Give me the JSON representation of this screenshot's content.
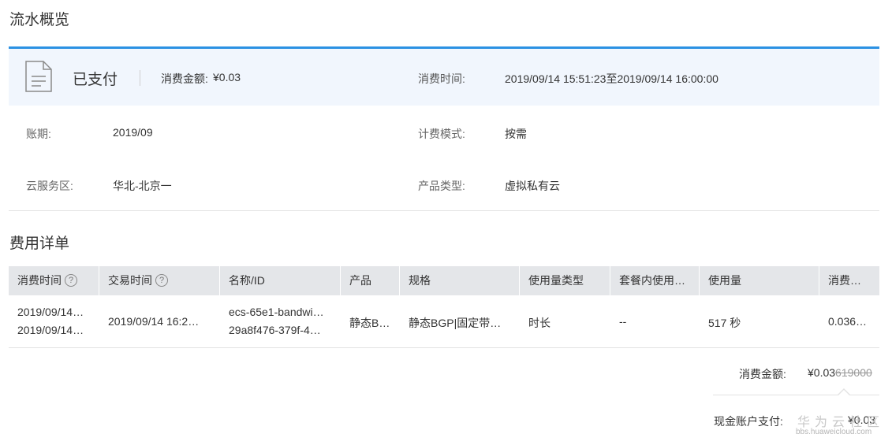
{
  "page_title": "流水概览",
  "summary": {
    "status": "已支付",
    "amount_label": "消费金额:",
    "amount_value": "¥0.03",
    "time_label": "消费时间:",
    "time_value": "2019/09/14 15:51:23至2019/09/14 16:00:00",
    "info": [
      {
        "label": "账期:",
        "value": "2019/09"
      },
      {
        "label": "计费模式:",
        "value": "按需"
      },
      {
        "label": "云服务区:",
        "value": "华北-北京一"
      },
      {
        "label": "产品类型:",
        "value": "虚拟私有云"
      }
    ]
  },
  "detail": {
    "title": "费用详单",
    "columns": [
      "消费时间",
      "交易时间",
      "名称/ID",
      "产品",
      "规格",
      "使用量类型",
      "套餐内使用…",
      "使用量",
      "消费…"
    ],
    "help_icon": "question-circle-icon",
    "row": {
      "consume_time": [
        "2019/09/14…",
        "2019/09/14…"
      ],
      "trade_time": "2019/09/14 16:2…",
      "name_id": [
        "ecs-65e1-bandwi…",
        "29a8f476-379f-4…"
      ],
      "product": "静态B…",
      "spec": "静态BGP|固定带…",
      "usage_type": "时长",
      "package_usage": "--",
      "usage": "517 秒",
      "amount": "0.036…"
    }
  },
  "totals": {
    "amount_label": "消费金额:",
    "amount_value": "¥0.03",
    "amount_strike": "619000",
    "cash_label": "现金账户支付:",
    "cash_value": "¥0.03"
  },
  "watermark": {
    "brand": "华为云社区",
    "url": "bbs.huaweicloud.com"
  },
  "colors": {
    "accent": "#2b91e3",
    "summary_bg": "#f1f6fd",
    "table_header_bg": "#e4e6e9"
  }
}
